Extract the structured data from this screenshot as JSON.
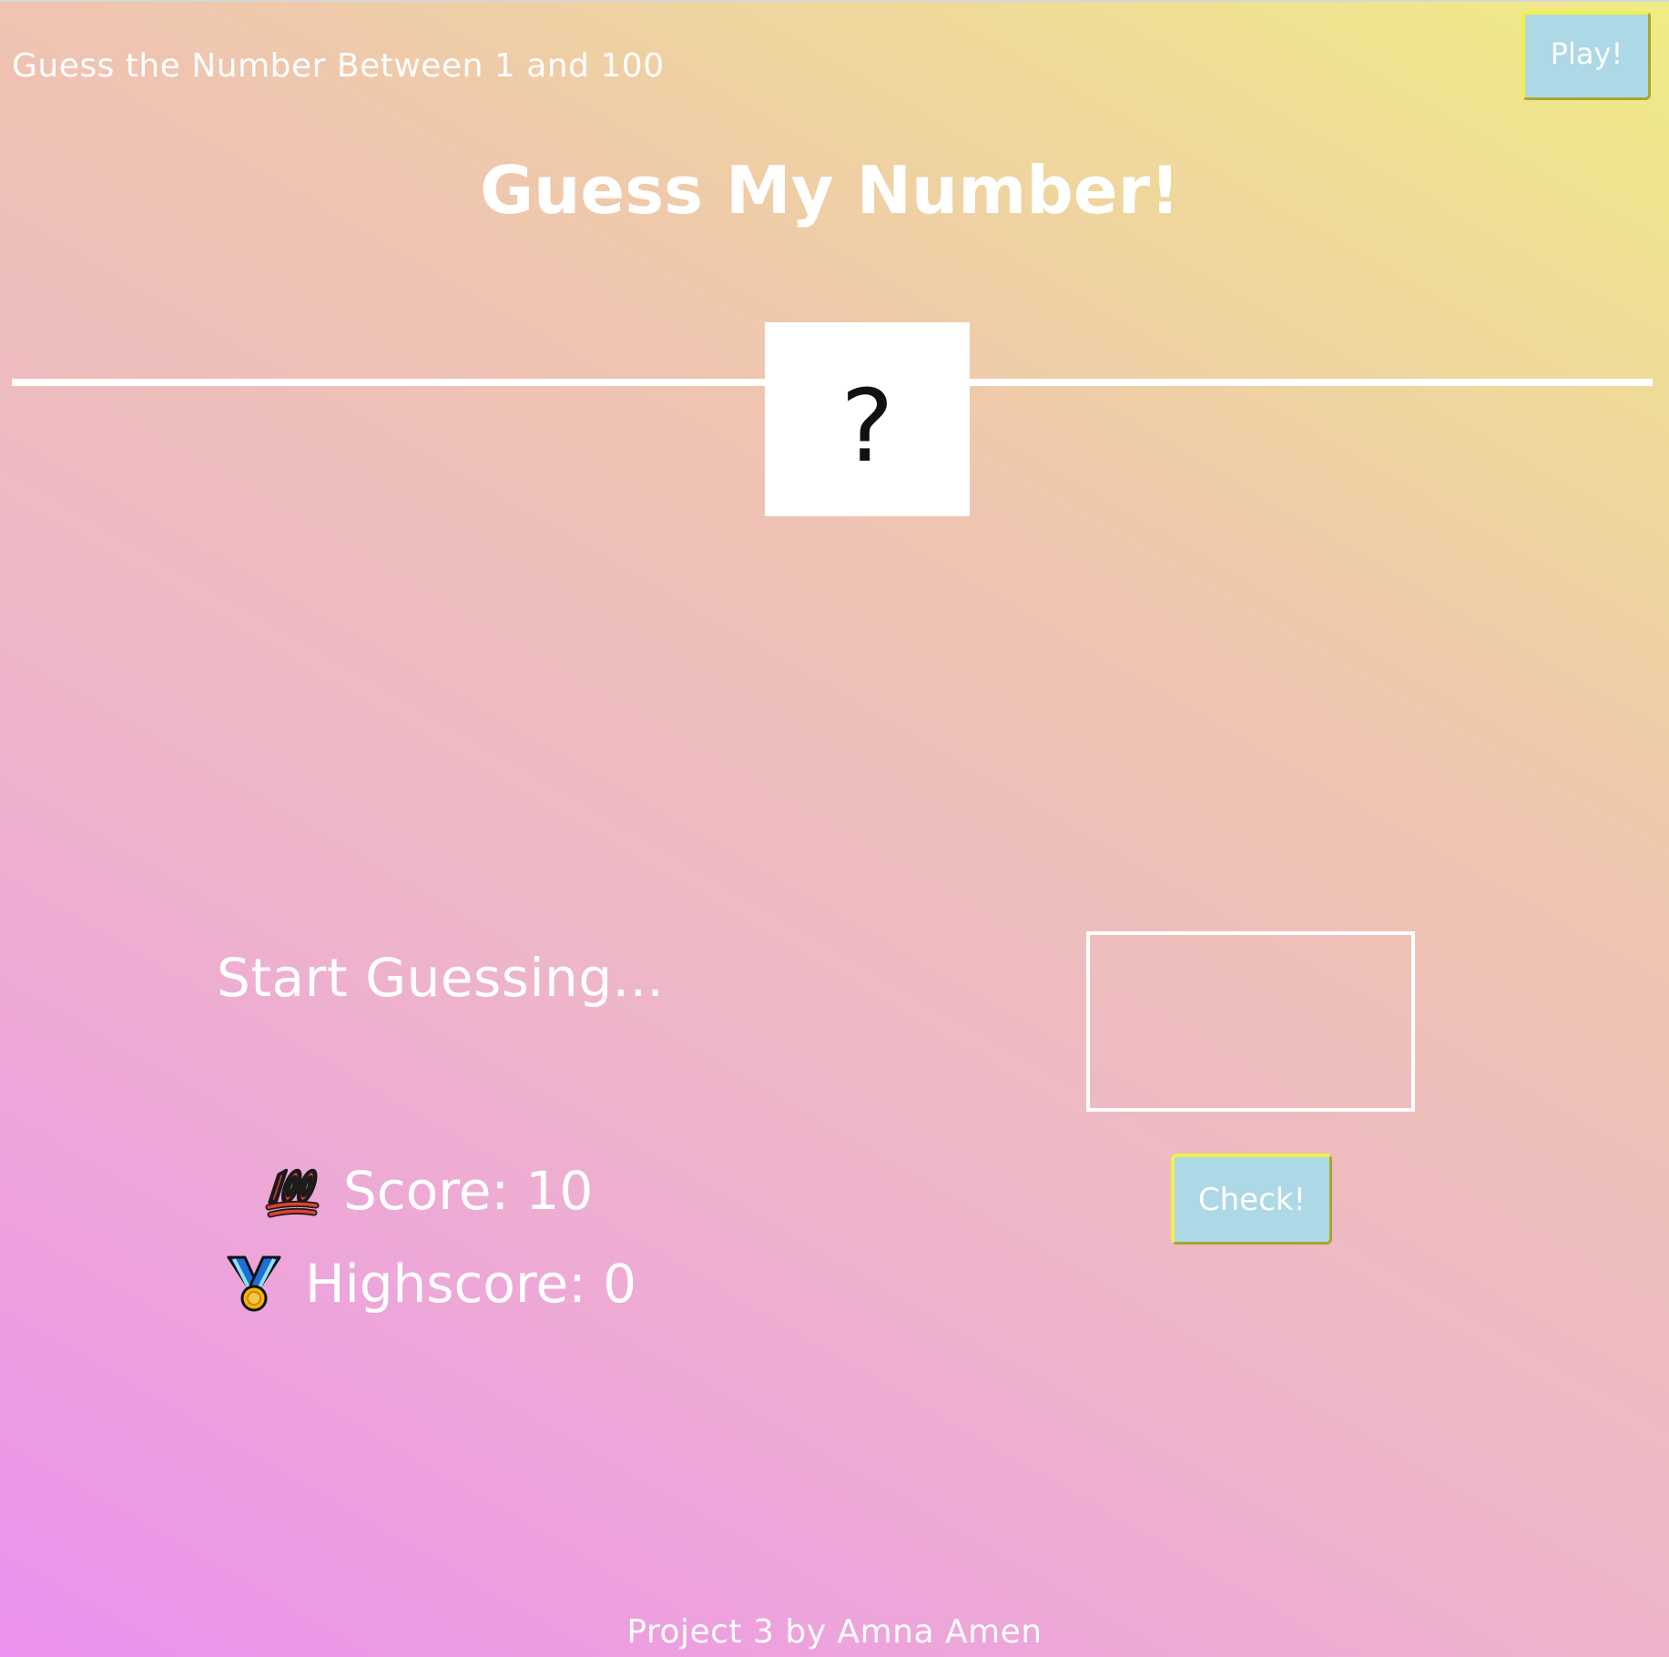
{
  "header": {
    "subtitle": "Guess the Number Between 1 and 100",
    "play_label": "Play!"
  },
  "game": {
    "title": "Guess My Number!",
    "secret_number_display": "?",
    "message": "Start Guessing...",
    "guess_input_value": "",
    "check_label": "Check!"
  },
  "stats": {
    "score_icon": "hundred-points-icon",
    "score_label": "Score: 10",
    "score_value": 10,
    "highscore_icon": "medal-icon",
    "highscore_label": "Highscore: 0",
    "highscore_value": 0
  },
  "footer": {
    "credit": "Project 3 by Amna Amen"
  },
  "colors": {
    "gradient_start": "#ec91ee",
    "gradient_end": "#efec86",
    "button_bg": "#add8e6",
    "button_border": "#f3ef4a",
    "text": "#ffffff"
  }
}
